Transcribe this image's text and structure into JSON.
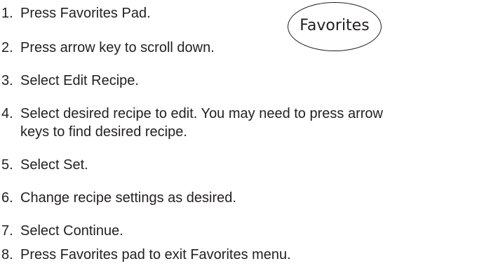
{
  "steps": [
    {
      "number": "1.",
      "lines": [
        "Press Favorites Pad."
      ]
    },
    {
      "number": "2.",
      "lines": [
        "Press arrow key to scroll down."
      ]
    },
    {
      "number": "3.",
      "lines": [
        "Select Edit Recipe."
      ]
    },
    {
      "number": "4.",
      "lines": [
        "Select desired recipe to edit.  You may need to press arrow",
        "keys to find desired recipe."
      ]
    },
    {
      "number": "5.",
      "lines": [
        "Select Set."
      ]
    },
    {
      "number": "6.",
      "lines": [
        "Change recipe settings as desired."
      ]
    },
    {
      "number": "7.",
      "lines": [
        "Select Continue."
      ]
    },
    {
      "number": "8.",
      "lines": [
        "Press Favorites pad to exit Favorites menu."
      ]
    }
  ],
  "favorites_pad": {
    "label": "Favorites"
  }
}
